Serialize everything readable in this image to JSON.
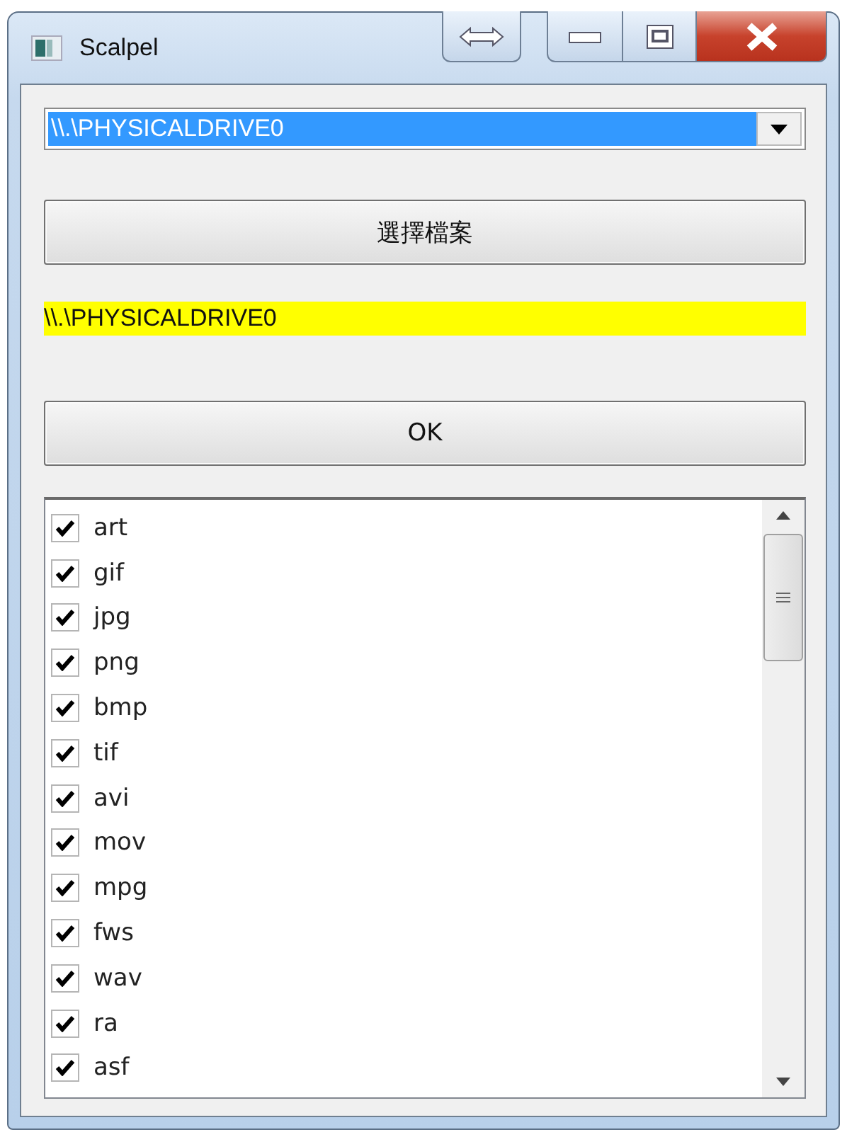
{
  "window": {
    "title": "Scalpel"
  },
  "drive_select": {
    "value": "\\\\.\\PHYSICALDRIVE0"
  },
  "choose_file_button": {
    "label": "選擇檔案"
  },
  "selected_path": {
    "text": "\\\\.\\PHYSICALDRIVE0"
  },
  "ok_button": {
    "label": "OK"
  },
  "file_types": [
    {
      "label": "art",
      "checked": true
    },
    {
      "label": "gif",
      "checked": true
    },
    {
      "label": "jpg",
      "checked": true
    },
    {
      "label": "png",
      "checked": true
    },
    {
      "label": "bmp",
      "checked": true
    },
    {
      "label": "tif",
      "checked": true
    },
    {
      "label": "avi",
      "checked": true
    },
    {
      "label": "mov",
      "checked": true
    },
    {
      "label": "mpg",
      "checked": true
    },
    {
      "label": "fws",
      "checked": true
    },
    {
      "label": "wav",
      "checked": true
    },
    {
      "label": "ra",
      "checked": true
    },
    {
      "label": "asf",
      "checked": true
    }
  ]
}
